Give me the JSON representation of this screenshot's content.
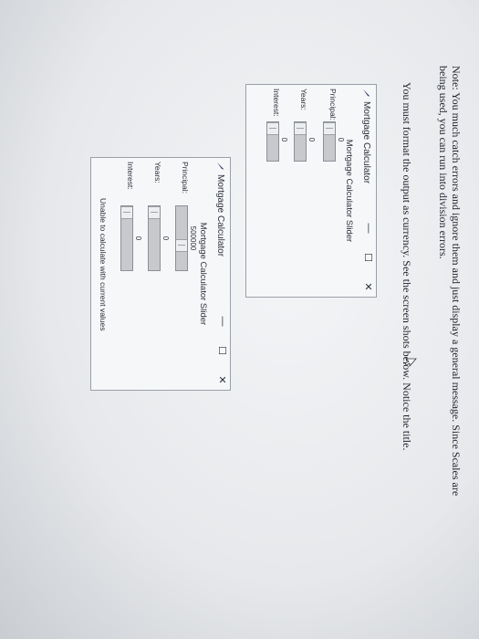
{
  "doc": {
    "note": "Note: You much catch errors and ignore them and just display a general message. Since Scales are being used, you can run into division errors.",
    "format_instruction": "You must format the output as currency. See the screen shots below. Notice the title."
  },
  "window1": {
    "title": "Mortgage Calculator",
    "heading": "Mortgage Calculator Slider",
    "principal_label": "Principal:",
    "principal_value": "0",
    "years_label": "Years:",
    "years_value": "0",
    "interest_label": "Interest:",
    "interest_value": "0"
  },
  "window2": {
    "title": "Mortgage Calculator",
    "heading": "Mortgage Calculator Slider",
    "principal_label": "Principal:",
    "principal_value": "500000",
    "years_label": "Years:",
    "years_value": "0",
    "interest_label": "Interest:",
    "interest_value": "0",
    "message": "Unable to calculate with current values"
  }
}
